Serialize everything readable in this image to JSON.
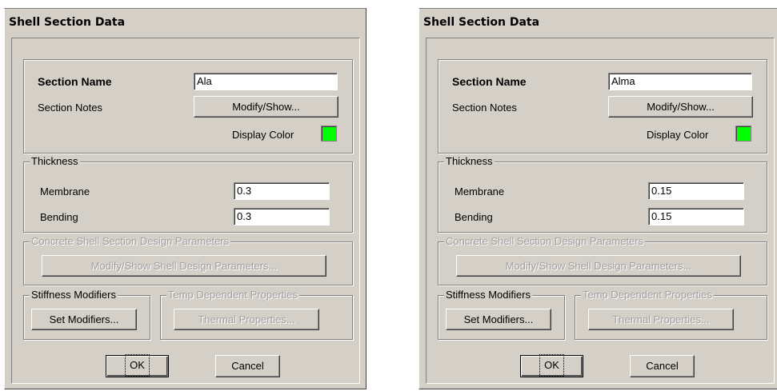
{
  "dialogs": [
    {
      "title": "Shell Section Data",
      "section_name_label": "Section Name",
      "section_name_value": "Ala",
      "section_notes_label": "Section Notes",
      "modify_show_button": "Modify/Show...",
      "display_color_label": "Display Color",
      "display_color": "#00ff00",
      "thickness_legend": "Thickness",
      "membrane_label": "Membrane",
      "membrane_value": "0.3",
      "bending_label": "Bending",
      "bending_value": "0.3",
      "concrete_legend": "Concrete Shell Section Design Parameters",
      "design_params_button": "Modify/Show Shell Design Parameters...",
      "stiffness_legend": "Stiffness Modifiers",
      "set_modifiers_button": "Set Modifiers...",
      "temp_legend": "Temp Dependent Properties",
      "thermal_button": "Thermal Properties...",
      "ok_button": "OK",
      "cancel_button": "Cancel"
    },
    {
      "title": "Shell Section Data",
      "section_name_label": "Section Name",
      "section_name_value": "Alma",
      "section_notes_label": "Section Notes",
      "modify_show_button": "Modify/Show...",
      "display_color_label": "Display Color",
      "display_color": "#00ff00",
      "thickness_legend": "Thickness",
      "membrane_label": "Membrane",
      "membrane_value": "0.15",
      "bending_label": "Bending",
      "bending_value": "0.15",
      "concrete_legend": "Concrete Shell Section Design Parameters",
      "design_params_button": "Modify/Show Shell Design Parameters...",
      "stiffness_legend": "Stiffness Modifiers",
      "set_modifiers_button": "Set Modifiers...",
      "temp_legend": "Temp Dependent Properties",
      "thermal_button": "Thermal Properties...",
      "ok_button": "OK",
      "cancel_button": "Cancel"
    }
  ]
}
